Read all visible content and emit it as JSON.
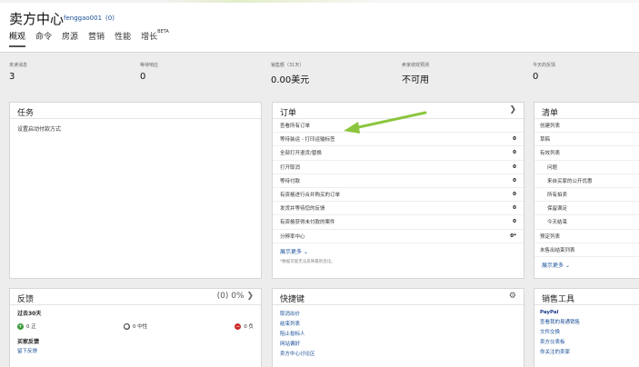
{
  "header": {
    "title": "卖方中心",
    "account_name": "fenggao001",
    "account_count": "(0)",
    "nav": [
      "概观",
      "命令",
      "房源",
      "营销",
      "性能",
      "增长"
    ],
    "nav_badge": "BETA"
  },
  "stats": [
    {
      "label": "未读消息",
      "value": "3"
    },
    {
      "label": "等待响应",
      "value": "0"
    },
    {
      "label": "销售额（31天）",
      "value": "0.00美元"
    },
    {
      "label": "卖家绩效预测",
      "value": "不可用"
    },
    {
      "label": "今天的反馈",
      "value": "0"
    }
  ],
  "tasks": {
    "title": "任务",
    "items": [
      "设置启动付款方式"
    ]
  },
  "orders": {
    "title": "订单",
    "rows": [
      {
        "label": "查看所有订单",
        "count": ""
      },
      {
        "label": "等待装运 - 打印运输标签",
        "count": "0"
      },
      {
        "label": "全部打开退货/替换",
        "count": "0"
      },
      {
        "label": "打开取消",
        "count": "0"
      },
      {
        "label": "等待付款",
        "count": "0"
      },
      {
        "label": "有资格进行合并购买的订单",
        "count": "0"
      },
      {
        "label": "发货并等待您的反馈",
        "count": "0"
      },
      {
        "label": "有资格获得未付款的案件",
        "count": "0"
      },
      {
        "label": "分辨率中心",
        "count": "0*"
      }
    ],
    "more": "展示更多",
    "note": "*数据可能无法反映最新变化。"
  },
  "lists": {
    "title": "清单",
    "rows": [
      {
        "label": "创建列表",
        "sub": false
      },
      {
        "label": "草稿",
        "sub": false
      },
      {
        "label": "有效列表",
        "sub": false
      },
      {
        "label": "问题",
        "sub": true
      },
      {
        "label": "来自买家的公开优惠",
        "sub": true
      },
      {
        "label": "所有拍卖",
        "sub": true
      },
      {
        "label": "保留满足",
        "sub": true
      },
      {
        "label": "今天结束",
        "sub": true
      },
      {
        "label": "预定列表",
        "sub": false
      },
      {
        "label": "未售出结束列表",
        "sub": false
      }
    ],
    "more": "展示更多"
  },
  "feedback": {
    "title": "反馈",
    "score": "(0)",
    "percent": "0%",
    "period": "过去30天",
    "positive_label": "正",
    "positive_count": "0",
    "neutral_label": "中性",
    "neutral_count": "0",
    "negative_label": "负",
    "negative_count": "0",
    "buyer_title": "买家反馈",
    "buyer_link": "留下反馈"
  },
  "shortcuts": {
    "title": "快捷键",
    "links": [
      "取消出价",
      "结束列表",
      "阻止投标人",
      "网站偏好",
      "卖方中心讨论区"
    ]
  },
  "tools": {
    "title": "销售工具",
    "links": [
      "PayPal",
      "查看我的易通销售",
      "文件交换",
      "卖方仪表板",
      "你关注的卖家"
    ]
  },
  "colors": {
    "link": "#1a4f98",
    "positive": "#3a9a3a",
    "neutral": "#444444",
    "negative": "#cc2b2b",
    "arrow": "#8cc63f"
  }
}
